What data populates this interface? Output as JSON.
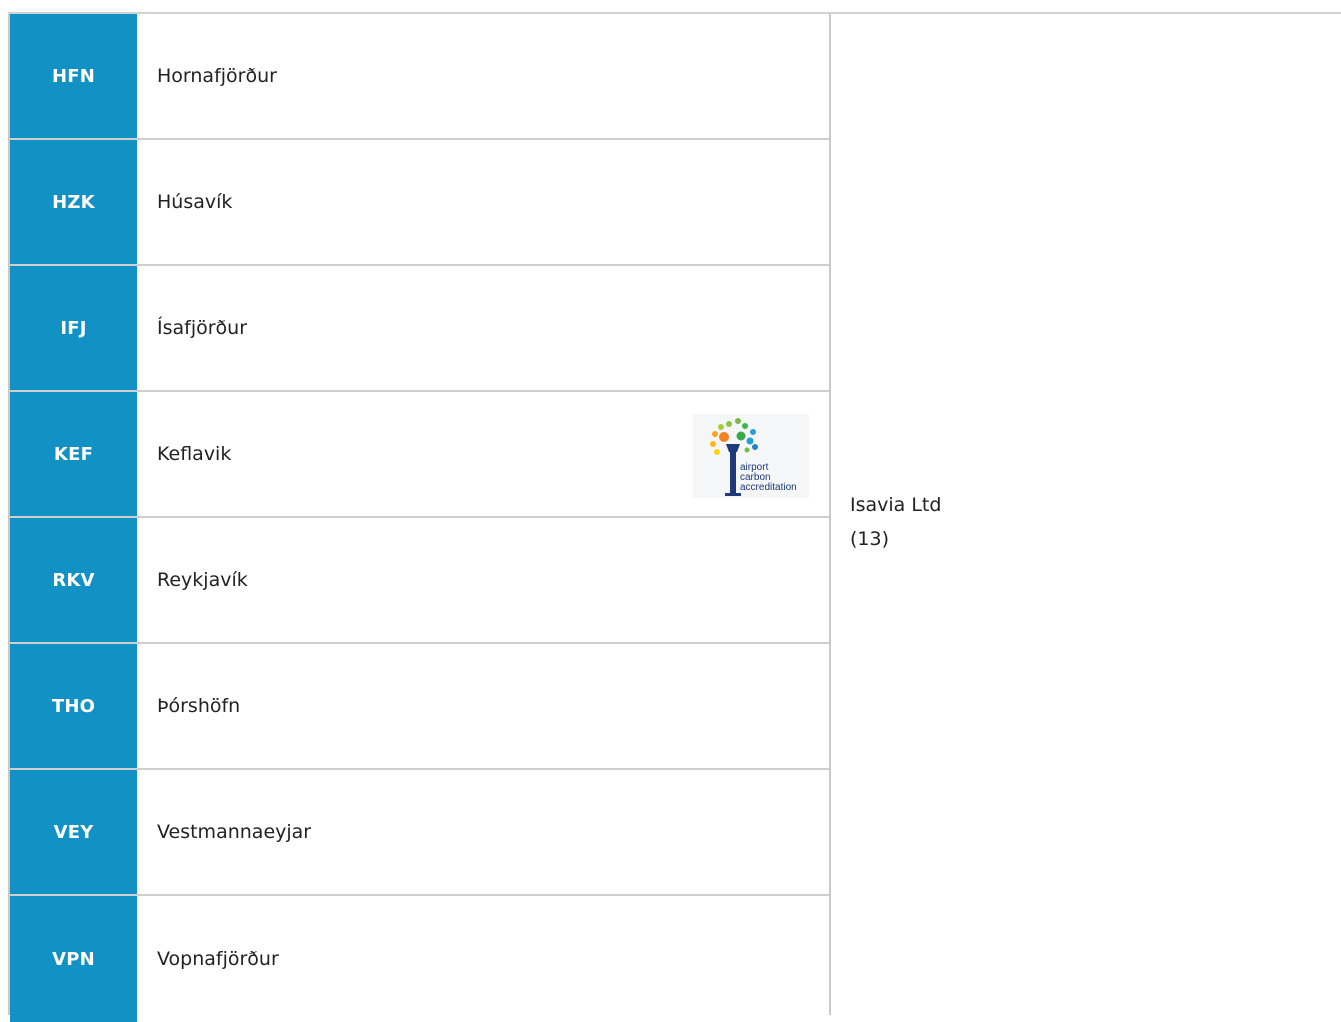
{
  "airports": [
    {
      "code": "HFN",
      "name": "Hornafjörður"
    },
    {
      "code": "HZK",
      "name": "Húsavík"
    },
    {
      "code": "IFJ",
      "name": "Ísafjörður"
    },
    {
      "code": "KEF",
      "name": "Keflavik"
    },
    {
      "code": "RKV",
      "name": "Reykjavík"
    },
    {
      "code": "THO",
      "name": "Þórshöfn"
    },
    {
      "code": "VEY",
      "name": "Vestmannaeyjar"
    },
    {
      "code": "VPN",
      "name": "Vopnafjörður"
    }
  ],
  "badge": {
    "lines": [
      "airport",
      "carbon",
      "accreditation"
    ],
    "icon": "airport-carbon-accreditation-logo"
  },
  "operator": {
    "name": "Isavia Ltd",
    "count": "(13)"
  },
  "colors": {
    "code_bg": "#1191c4",
    "code_text": "#ffffff",
    "logo_blue": "#1e3a78"
  }
}
